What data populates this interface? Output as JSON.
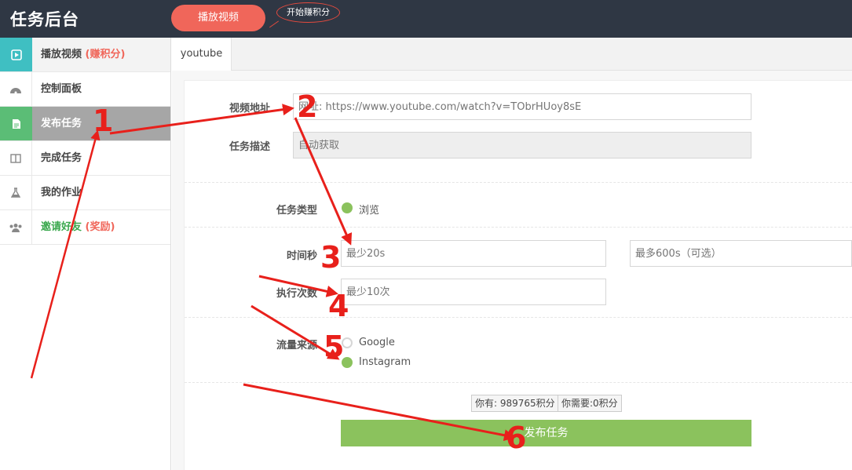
{
  "header": {
    "brand": "任务后台",
    "play_button": "播放视频",
    "bubble_text": "开始赚积分"
  },
  "sidebar": {
    "items": [
      {
        "icon": "play-icon",
        "label": "播放视频",
        "extra": "(赚积分)"
      },
      {
        "icon": "dashboard-icon",
        "label": "控制面板",
        "extra": ""
      },
      {
        "icon": "document-icon",
        "label": "发布任务",
        "extra": ""
      },
      {
        "icon": "columns-icon",
        "label": "完成任务",
        "extra": ""
      },
      {
        "icon": "flask-icon",
        "label": "我的作业",
        "extra": ""
      },
      {
        "icon": "users-icon",
        "label": "邀请好友",
        "extra": "(奖励)"
      }
    ]
  },
  "tabs": [
    {
      "label": "youtube"
    }
  ],
  "form": {
    "video_url": {
      "label": "视频地址",
      "placeholder": "网址: https://www.youtube.com/watch?v=TObrHUoy8sE"
    },
    "description": {
      "label": "任务描述",
      "placeholder": "自动获取"
    },
    "task_type": {
      "label": "任务类型",
      "option": "浏览"
    },
    "duration": {
      "label": "时间秒",
      "min_placeholder": "最少20s",
      "max_placeholder": "最多600s（可选）"
    },
    "exec_count": {
      "label": "执行次数",
      "placeholder": "最少10次"
    },
    "traffic_source": {
      "label": "流量来源",
      "options": [
        "Google",
        "Instagram"
      ],
      "selected": "Instagram"
    },
    "points_have": "你有: 989765积分",
    "points_need": "你需要:0积分",
    "submit_label": "发布任务"
  },
  "annotations": [
    "1",
    "2",
    "3",
    "4",
    "5",
    "6"
  ],
  "colors": {
    "topbar": "#2f3744",
    "accent_red": "#f0665a",
    "accent_green": "#8bc25d",
    "annotation_red": "#e8201b"
  }
}
